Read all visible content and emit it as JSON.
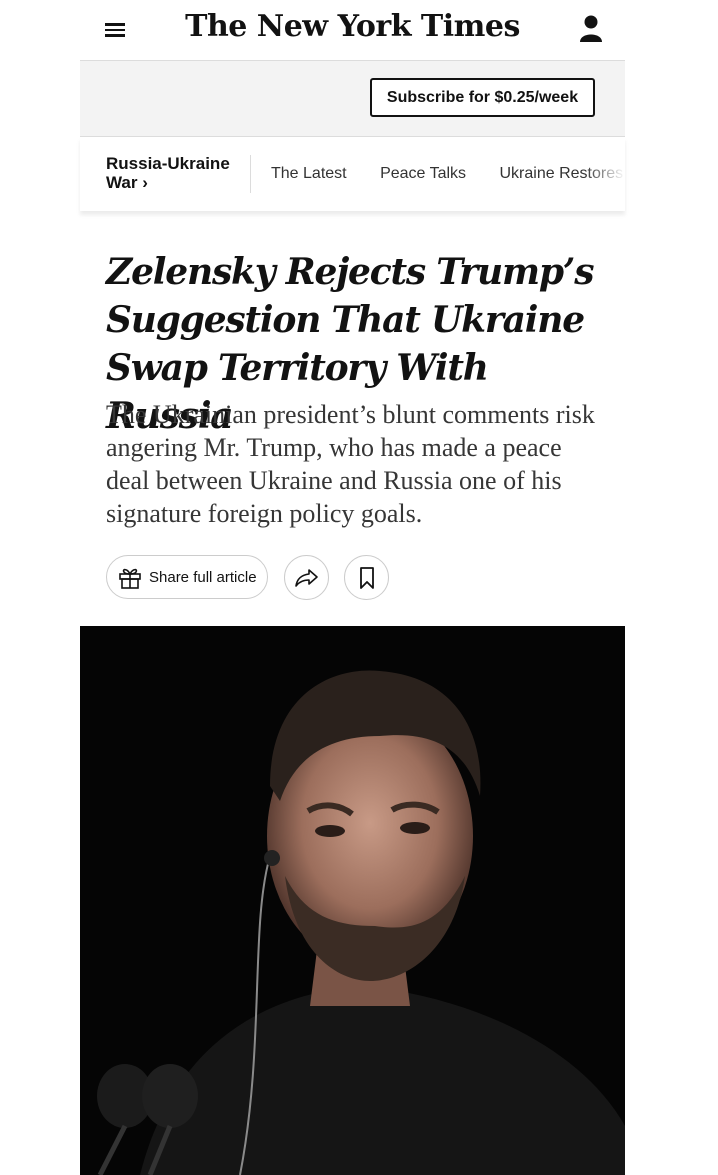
{
  "header": {
    "logo": "The New York Times",
    "menu_icon": "hamburger-menu-icon",
    "user_icon": "user-account-icon"
  },
  "subscribe": {
    "label": "Subscribe for $0.25/week"
  },
  "section_nav": {
    "title": "Russia-Ukraine War ›",
    "links": [
      "The Latest",
      "Peace Talks",
      "Ukraine Restores W"
    ]
  },
  "article": {
    "headline": "Zelensky Rejects Trump’s Suggestion That Ukraine Swap Territory With Russia",
    "summary": "The Ukrainian president’s blunt comments risk angering Mr. Trump, who has made a peace deal between Ukraine and Russia one of his signature foreign policy goals."
  },
  "actions": {
    "share_label": "Share full article",
    "gift_icon": "gift-icon",
    "share_icon": "share-arrow-icon",
    "bookmark_icon": "bookmark-icon"
  },
  "colors": {
    "text": "#121212",
    "subbar_bg": "#f3f3f3",
    "border": "#dcdcdc",
    "photo_bg": "#050505"
  }
}
